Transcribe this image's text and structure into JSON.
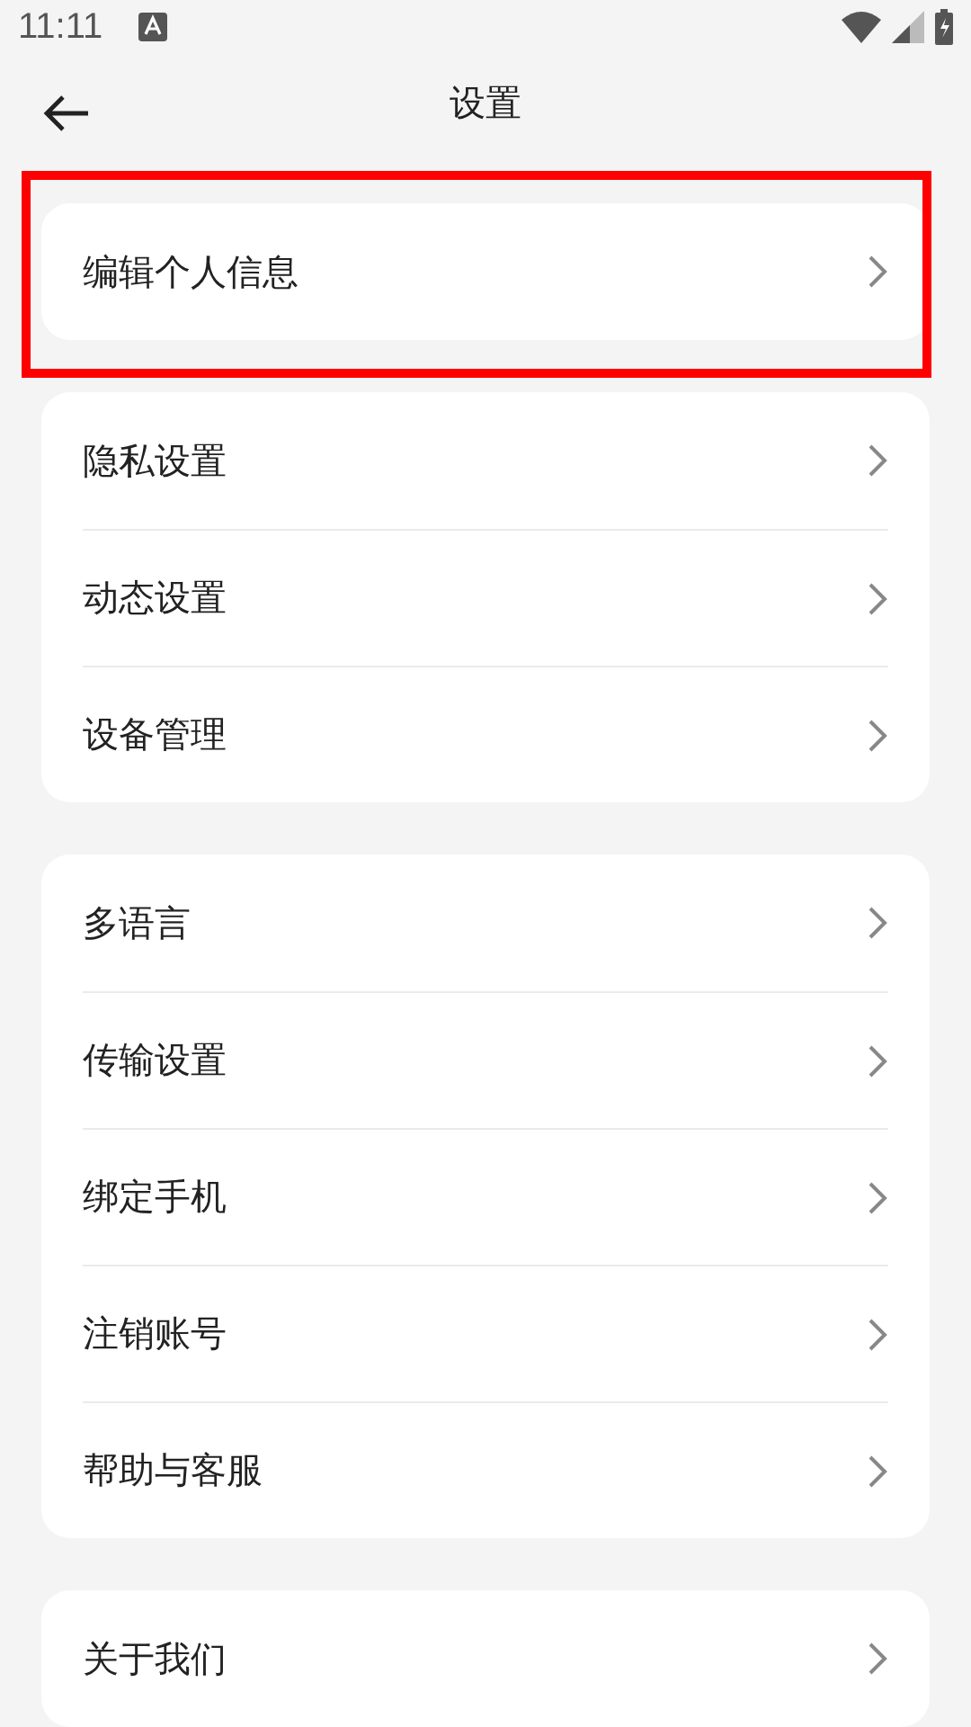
{
  "status_bar": {
    "time": "11:11"
  },
  "header": {
    "title": "设置"
  },
  "groups": [
    {
      "highlighted": true,
      "items": [
        {
          "label": "编辑个人信息"
        }
      ]
    },
    {
      "highlighted": false,
      "items": [
        {
          "label": "隐私设置"
        },
        {
          "label": "动态设置"
        },
        {
          "label": "设备管理"
        }
      ]
    },
    {
      "highlighted": false,
      "items": [
        {
          "label": "多语言"
        },
        {
          "label": "传输设置"
        },
        {
          "label": "绑定手机"
        },
        {
          "label": "注销账号"
        },
        {
          "label": "帮助与客服"
        }
      ]
    },
    {
      "highlighted": false,
      "items": [
        {
          "label": "关于我们"
        }
      ]
    }
  ]
}
